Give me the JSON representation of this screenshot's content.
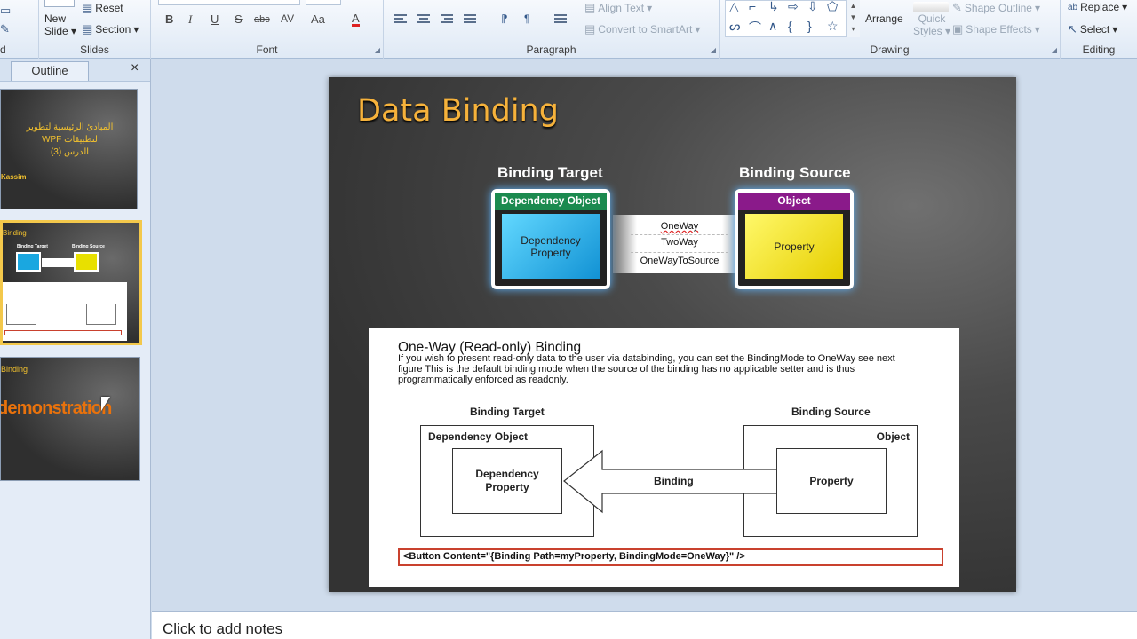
{
  "ribbon": {
    "slides": {
      "group_label": "Slides",
      "new_slide": "New",
      "new_slide_2": "Slide",
      "reset": "Reset",
      "section": "Section"
    },
    "font": {
      "group_label": "Font",
      "bold": "B",
      "italic": "I",
      "underline": "U",
      "strike": "S",
      "abc": "abc",
      "spacing": "AV",
      "case": "Aa",
      "color": "A"
    },
    "paragraph": {
      "group_label": "Paragraph",
      "align_text": "Align Text",
      "convert_smartart": "Convert to SmartArt"
    },
    "drawing": {
      "group_label": "Drawing",
      "arrange": "Arrange",
      "quick_styles": "Quick",
      "quick_styles_2": "Styles",
      "shape_outline": "Shape Outline",
      "shape_effects": "Shape Effects"
    },
    "editing": {
      "group_label": "Editing",
      "replace": "Replace",
      "select": "Select"
    },
    "clipboard_label": "d"
  },
  "left_panel": {
    "tab_outline": "Outline",
    "close": "×",
    "thumb1": {
      "arabic_line1": "المبادئ الرئيسية لتطوير لتطبيقات WPF",
      "arabic_line2": "الدرس (3)",
      "name": "Kassim"
    },
    "thumb2": {
      "title": "Binding",
      "target": "Binding Target",
      "source": "Binding Source"
    },
    "thumb3": {
      "title": "Binding",
      "demo": "demonstration"
    }
  },
  "slide": {
    "title": "Data Binding",
    "target_label": "Binding Target",
    "source_label": "Binding Source",
    "target_header": "Dependency Object",
    "target_body": "Dependency Property",
    "source_header": "Object",
    "source_body": "Property",
    "modes": [
      "OneWay",
      "TwoWay",
      "OneWayToSource"
    ],
    "doc": {
      "heading": "One-Way (Read-only) Binding",
      "text": "If you wish to present read-only data to the user via databinding, you can set the BindingMode to OneWay see next  figure  This is the default binding mode when the source of the binding has no applicable setter and is thus programmatically enforced as readonly.",
      "target_label": "Binding Target",
      "source_label": "Binding Source",
      "dep_object": "Dependency Object",
      "dep_property": "Dependency Property",
      "object": "Object",
      "property": "Property",
      "binding": "Binding",
      "code": "<Button Content=\"{Binding Path=myProperty, BindingMode=OneWay}\" />"
    }
  },
  "notes": {
    "placeholder": "Click to add notes"
  },
  "colors": {
    "accent_orange": "#f6b23b",
    "target_cyan": "#1aa7e0",
    "source_yellow": "#f5e400",
    "header_green": "#1b8a4f",
    "header_purple": "#8a1a8a"
  }
}
